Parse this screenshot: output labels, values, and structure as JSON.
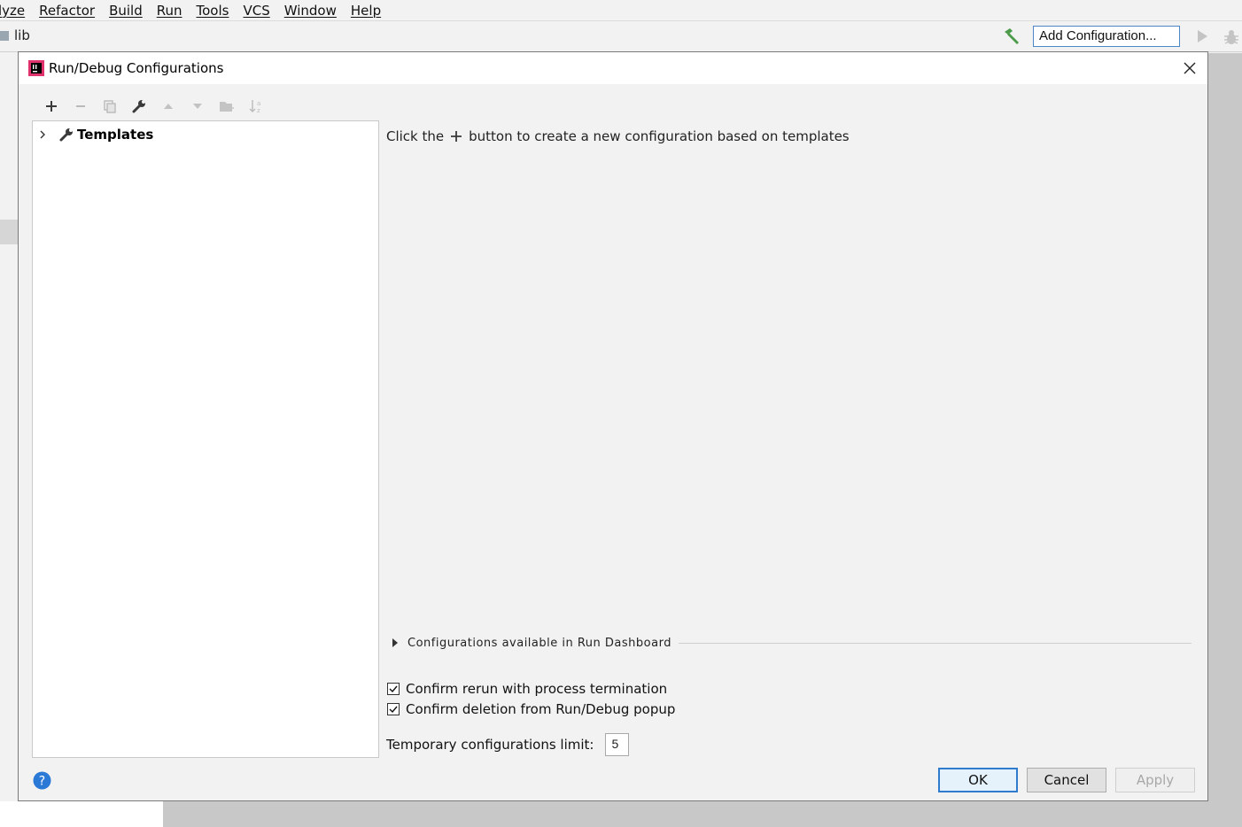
{
  "menubar": {
    "items": [
      "lyze",
      "Refactor",
      "Build",
      "Run",
      "Tools",
      "VCS",
      "Window",
      "Help"
    ]
  },
  "navbar": {
    "breadcrumb": "lib",
    "add_configuration": "Add Configuration..."
  },
  "dialog": {
    "title": "Run/Debug Configurations",
    "toolbar": {
      "add": "add-icon",
      "remove": "remove-icon",
      "copy": "copy-icon",
      "edit_templates": "wrench-icon",
      "move_up": "arrow-up-icon",
      "move_down": "arrow-down-icon",
      "move_to_folder": "folder-icon",
      "sort": "sort-icon"
    },
    "tree": {
      "items": [
        {
          "label": "Templates",
          "expanded": false
        }
      ]
    },
    "hint": {
      "before": "Click the",
      "after": "button to create a new configuration based on templates"
    },
    "run_dashboard": {
      "label": "Configurations available in Run Dashboard",
      "expanded": false
    },
    "options": {
      "confirm_rerun": {
        "label": "Confirm rerun with process termination",
        "checked": true
      },
      "confirm_deletion": {
        "label": "Confirm deletion from Run/Debug popup",
        "checked": true
      }
    },
    "temp_limit": {
      "label": "Temporary configurations limit:",
      "value": "5"
    },
    "buttons": {
      "ok": "OK",
      "cancel": "Cancel",
      "apply": "Apply"
    }
  },
  "colors": {
    "accent": "#2e7bd0",
    "hammer_green": "#4b9b4a",
    "help_blue": "#2b79d7"
  }
}
